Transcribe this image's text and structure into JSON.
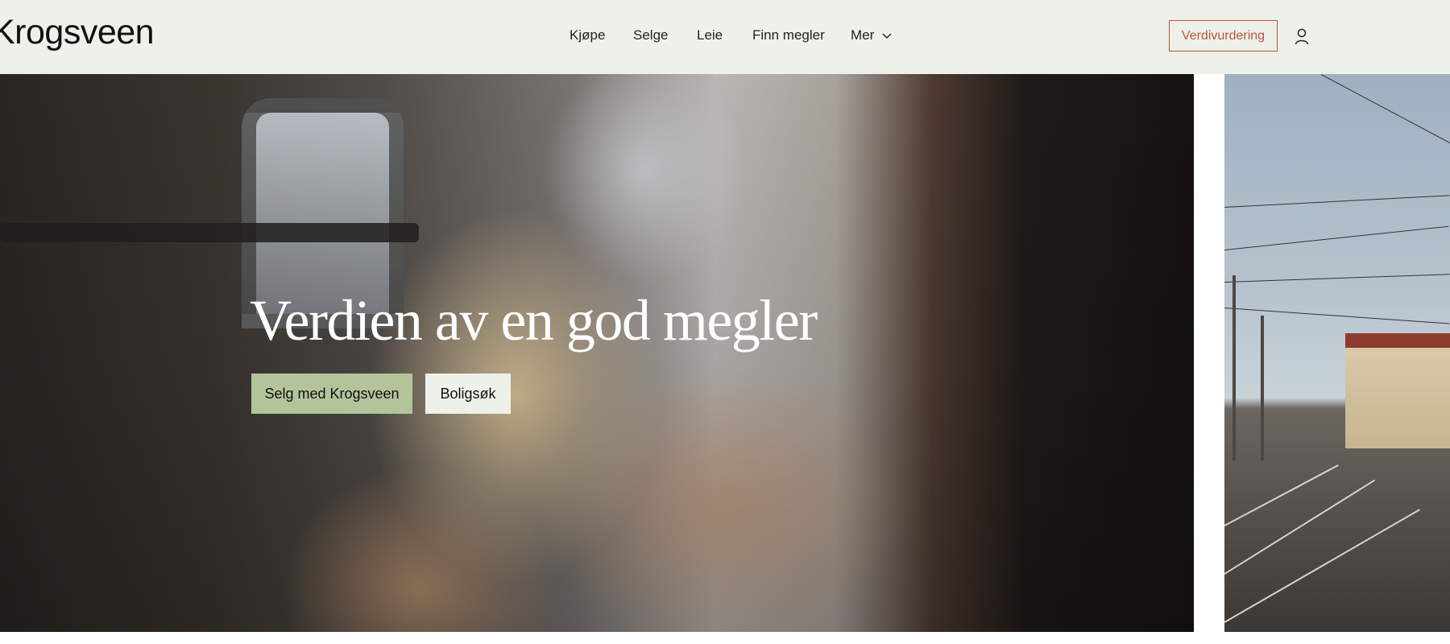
{
  "header": {
    "logo": "Krogsveen",
    "nav": [
      {
        "label": "Kjøpe"
      },
      {
        "label": "Selge"
      },
      {
        "label": "Leie"
      },
      {
        "label": "Finn megler"
      },
      {
        "label": "Mer",
        "icon": "chevron-down-icon"
      }
    ],
    "cta": "Verdivurdering",
    "user_icon": "user-icon"
  },
  "hero": {
    "title": "Verdien av en god megler",
    "primary_button": "Selg med Krogsveen",
    "secondary_button": "Boligsøk"
  },
  "colors": {
    "header_bg": "#eef0ea",
    "accent": "#b9563c",
    "primary_button_bg": "#b3c49a",
    "secondary_button_bg": "#eef0ea"
  }
}
